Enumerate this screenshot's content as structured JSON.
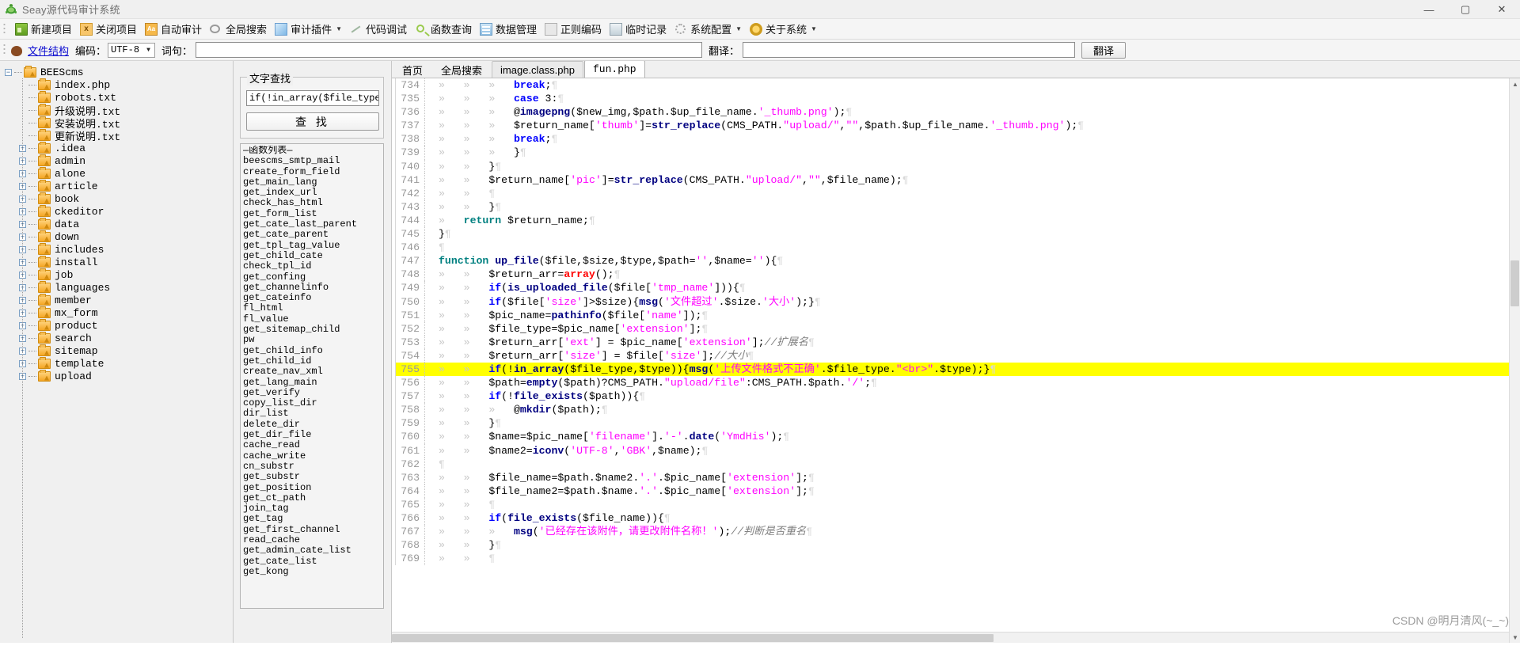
{
  "window": {
    "title": "Seay源代码审计系统",
    "app_icon": "turtle-icon",
    "minimize": "—",
    "maximize": "▢",
    "close": "✕"
  },
  "toolbar": {
    "items": [
      {
        "label": "新建项目",
        "icon": "new-project-icon",
        "caret": false
      },
      {
        "label": "关闭项目",
        "icon": "close-project-icon",
        "caret": false
      },
      {
        "label": "自动审计",
        "icon": "auto-audit-icon",
        "caret": false
      },
      {
        "label": "全局搜索",
        "icon": "global-search-icon",
        "caret": false
      },
      {
        "label": "审计插件",
        "icon": "audit-plugin-icon",
        "caret": true
      },
      {
        "label": "代码调试",
        "icon": "code-debug-icon",
        "caret": false
      },
      {
        "label": "函数查询",
        "icon": "function-query-icon",
        "caret": false
      },
      {
        "label": "数据管理",
        "icon": "data-manage-icon",
        "caret": false
      },
      {
        "label": "正则编码",
        "icon": "regex-encode-icon",
        "caret": false
      },
      {
        "label": "临时记录",
        "icon": "temp-note-icon",
        "caret": false
      },
      {
        "label": "系统配置",
        "icon": "system-config-icon",
        "caret": true
      },
      {
        "label": "关于系统",
        "icon": "about-icon",
        "caret": true
      }
    ]
  },
  "row2": {
    "file_structure_label": "文件结构",
    "encoding_label": "编码：",
    "encoding_value": "UTF-8",
    "phrase_label": "词句：",
    "phrase_value": "",
    "phrase_placeholder": "",
    "translate_label": "翻译：",
    "translate_value": "",
    "translate_placeholder": "",
    "translate_button": "翻译"
  },
  "tree": {
    "root": {
      "label": "BEEScms",
      "expander": "−"
    },
    "children": [
      {
        "label": "index.php",
        "expander": ""
      },
      {
        "label": "robots.txt",
        "expander": ""
      },
      {
        "label": "升级说明.txt",
        "expander": ""
      },
      {
        "label": "安装说明.txt",
        "expander": ""
      },
      {
        "label": "更新说明.txt",
        "expander": ""
      },
      {
        "label": ".idea",
        "expander": "+"
      },
      {
        "label": "admin",
        "expander": "+"
      },
      {
        "label": "alone",
        "expander": "+"
      },
      {
        "label": "article",
        "expander": "+"
      },
      {
        "label": "book",
        "expander": "+"
      },
      {
        "label": "ckeditor",
        "expander": "+"
      },
      {
        "label": "data",
        "expander": "+"
      },
      {
        "label": "down",
        "expander": "+"
      },
      {
        "label": "includes",
        "expander": "+"
      },
      {
        "label": "install",
        "expander": "+"
      },
      {
        "label": "job",
        "expander": "+"
      },
      {
        "label": "languages",
        "expander": "+"
      },
      {
        "label": "member",
        "expander": "+"
      },
      {
        "label": "mx_form",
        "expander": "+"
      },
      {
        "label": "product",
        "expander": "+"
      },
      {
        "label": "search",
        "expander": "+"
      },
      {
        "label": "sitemap",
        "expander": "+"
      },
      {
        "label": "template",
        "expander": "+"
      },
      {
        "label": "upload",
        "expander": "+"
      }
    ]
  },
  "search_panel": {
    "group_title": "文字查找",
    "query_value": "if(!in_array($file_type,$typ",
    "find_button": "查 找",
    "function_list_header": "—函数列表—",
    "functions": [
      "beescms_smtp_mail",
      "create_form_field",
      "get_main_lang",
      "get_index_url",
      "check_has_html",
      "get_form_list",
      "get_cate_last_parent",
      "get_cate_parent",
      "get_tpl_tag_value",
      "get_child_cate",
      "check_tpl_id",
      "get_confing",
      "get_channelinfo",
      "get_cateinfo",
      "fl_html",
      "fl_value",
      "get_sitemap_child",
      "pw",
      "get_child_info",
      "get_child_id",
      "create_nav_xml",
      "get_lang_main",
      "get_verify",
      "copy_list_dir",
      "dir_list",
      "delete_dir",
      "get_dir_file",
      "cache_read",
      "cache_write",
      "cn_substr",
      "get_substr",
      "get_position",
      "get_ct_path",
      "join_tag",
      "get_tag",
      "get_first_channel",
      "read_cache",
      "get_admin_cate_list",
      "get_cate_list",
      "get_kong"
    ]
  },
  "tabs": [
    {
      "label": "首页",
      "active": false,
      "plain": true
    },
    {
      "label": "全局搜索",
      "active": false,
      "plain": true
    },
    {
      "label": "image.class.php",
      "active": false,
      "plain": false
    },
    {
      "label": "fun.php",
      "active": true,
      "plain": false
    }
  ],
  "editor": {
    "first_line": 734,
    "highlight_line": 755,
    "lines": [
      {
        "n": 734,
        "tabs": 3,
        "html": "<span class=\"kw\">break</span>;"
      },
      {
        "n": 735,
        "tabs": 3,
        "html": "<span class=\"kw\">case</span> <span class=\"num\">3</span>:"
      },
      {
        "n": 736,
        "tabs": 3,
        "html": "@<span class=\"fn\">imagepng</span>($new_img,$path.$up_file_name.<span class=\"str\">'_thumb.png'</span>);"
      },
      {
        "n": 737,
        "tabs": 3,
        "html": "$return_name[<span class=\"str\">'thumb'</span>]=<span class=\"fn\">str_replace</span>(CMS_PATH.<span class=\"str\">\"upload/\"</span>,<span class=\"str\">\"\"</span>,$path.$up_file_name.<span class=\"str\">'_thumb.png'</span>);"
      },
      {
        "n": 738,
        "tabs": 3,
        "html": "<span class=\"kw\">break</span>;"
      },
      {
        "n": 739,
        "tabs": 3,
        "html": "}"
      },
      {
        "n": 740,
        "tabs": 2,
        "html": "}"
      },
      {
        "n": 741,
        "tabs": 2,
        "html": "$return_name[<span class=\"str\">'pic'</span>]=<span class=\"fn\">str_replace</span>(CMS_PATH.<span class=\"str\">\"upload/\"</span>,<span class=\"str\">\"\"</span>,$file_name);"
      },
      {
        "n": 742,
        "tabs": 2,
        "html": ""
      },
      {
        "n": 743,
        "tabs": 2,
        "html": "}"
      },
      {
        "n": 744,
        "tabs": 1,
        "html": "<span class=\"kw2\">return</span> $return_name;"
      },
      {
        "n": 745,
        "tabs": 0,
        "html": "}"
      },
      {
        "n": 746,
        "tabs": 0,
        "html": ""
      },
      {
        "n": 747,
        "tabs": 0,
        "html": "<span class=\"kw2\">function</span> <span class=\"fn\">up_file</span>($file,$size,$type,$path=<span class=\"str\">''</span>,$name=<span class=\"str\">''</span>){"
      },
      {
        "n": 748,
        "tabs": 2,
        "html": "$return_arr=<span class=\"red\">array</span>();"
      },
      {
        "n": 749,
        "tabs": 2,
        "html": "<span class=\"kw\">if</span>(<span class=\"fn\">is_uploaded_file</span>($file[<span class=\"str\">'tmp_name'</span>])){"
      },
      {
        "n": 750,
        "tabs": 2,
        "html": "<span class=\"kw\">if</span>($file[<span class=\"str\">'size'</span>]&gt;$size){<span class=\"fn\">msg</span>(<span class=\"str\">'文件超过'</span>.$size.<span class=\"str\">'大小'</span>);}"
      },
      {
        "n": 751,
        "tabs": 2,
        "html": "$pic_name=<span class=\"fn\">pathinfo</span>($file[<span class=\"str\">'name'</span>]);"
      },
      {
        "n": 752,
        "tabs": 2,
        "html": "$file_type=$pic_name[<span class=\"str\">'extension'</span>];"
      },
      {
        "n": 753,
        "tabs": 2,
        "html": "$return_arr[<span class=\"str\">'ext'</span>] = $pic_name[<span class=\"str\">'extension'</span>];<span class=\"cmt\">//扩展名</span>"
      },
      {
        "n": 754,
        "tabs": 2,
        "html": "$return_arr[<span class=\"str\">'size'</span>] = $file[<span class=\"str\">'size'</span>];<span class=\"cmt\">//大小</span>"
      },
      {
        "n": 755,
        "tabs": 2,
        "html": "<span class=\"kw\">if</span>(!<span class=\"fn\">in_array</span>($file_type,$type)){<span class=\"fn\">msg</span>(<span class=\"str\">'上传文件格式不正确'</span>.$file_type.<span class=\"str\">\"&lt;br&gt;\"</span>.$type);}"
      },
      {
        "n": 756,
        "tabs": 2,
        "html": "$path=<span class=\"fn\">empty</span>($path)?CMS_PATH.<span class=\"str\">\"upload/file\"</span>:CMS_PATH.$path.<span class=\"str\">'/'</span>;"
      },
      {
        "n": 757,
        "tabs": 2,
        "html": "<span class=\"kw\">if</span>(!<span class=\"fn\">file_exists</span>($path)){"
      },
      {
        "n": 758,
        "tabs": 3,
        "html": "@<span class=\"fn\">mkdir</span>($path);"
      },
      {
        "n": 759,
        "tabs": 2,
        "html": "}"
      },
      {
        "n": 760,
        "tabs": 2,
        "html": "$name=$pic_name[<span class=\"str\">'filename'</span>].<span class=\"str\">'-'</span>.<span class=\"fn\">date</span>(<span class=\"str\">'YmdHis'</span>);"
      },
      {
        "n": 761,
        "tabs": 2,
        "html": "$name2=<span class=\"fn\">iconv</span>(<span class=\"str\">'UTF-8'</span>,<span class=\"str\">'GBK'</span>,$name);"
      },
      {
        "n": 762,
        "tabs": 0,
        "html": ""
      },
      {
        "n": 763,
        "tabs": 2,
        "html": "$file_name=$path.$name2.<span class=\"str\">'.'</span>.$pic_name[<span class=\"str\">'extension'</span>];"
      },
      {
        "n": 764,
        "tabs": 2,
        "html": "$file_name2=$path.$name.<span class=\"str\">'.'</span>.$pic_name[<span class=\"str\">'extension'</span>];"
      },
      {
        "n": 765,
        "tabs": 2,
        "html": ""
      },
      {
        "n": 766,
        "tabs": 2,
        "html": "<span class=\"kw\">if</span>(<span class=\"fn\">file_exists</span>($file_name)){"
      },
      {
        "n": 767,
        "tabs": 3,
        "html": "<span class=\"fn\">msg</span>(<span class=\"str\">'已经存在该附件，请更改附件名称！'</span>);<span class=\"cmt\">//判断是否重名</span>"
      },
      {
        "n": 768,
        "tabs": 2,
        "html": "}"
      },
      {
        "n": 769,
        "tabs": 2,
        "html": ""
      }
    ]
  },
  "watermark": "CSDN @明月清风(~_~)"
}
